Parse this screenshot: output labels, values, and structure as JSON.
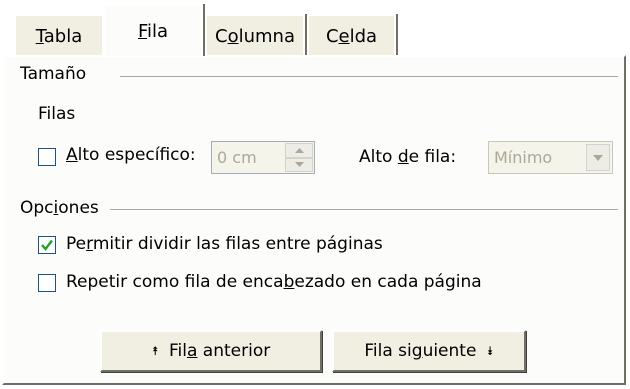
{
  "tabs": [
    {
      "pre": "",
      "key": "T",
      "post": "abla"
    },
    {
      "pre": "",
      "key": "F",
      "post": "ila"
    },
    {
      "pre": "C",
      "key": "o",
      "post": "lumna"
    },
    {
      "pre": "C",
      "key": "e",
      "post": "lda"
    }
  ],
  "size_group": {
    "title": "Tamaño"
  },
  "rows": {
    "subtitle": "Filas",
    "specific_height": {
      "pre": "",
      "key": "A",
      "post": "lto específico:",
      "checked": false
    },
    "height_value": "0 cm",
    "row_height_label": {
      "pre": "Alto ",
      "key": "d",
      "post": "e fila:"
    },
    "row_height_select": "Mínimo"
  },
  "options_group": {
    "pre": "Opc",
    "key": "i",
    "post": "ones"
  },
  "options": {
    "allow_split": {
      "pre": "Pe",
      "key": "r",
      "post": "mitir dividir las filas entre páginas",
      "checked": true
    },
    "repeat_header": {
      "pre": "Repetir como fila de enca",
      "key": "b",
      "post": "ezado en cada página",
      "checked": false
    }
  },
  "buttons": {
    "prev": {
      "pre": "Fil",
      "key": "a",
      "post": " anterior",
      "icon": "⯭"
    },
    "next": {
      "pre": "Fila si",
      "key": "g",
      "post": "uiente",
      "icon": "⯯"
    }
  }
}
